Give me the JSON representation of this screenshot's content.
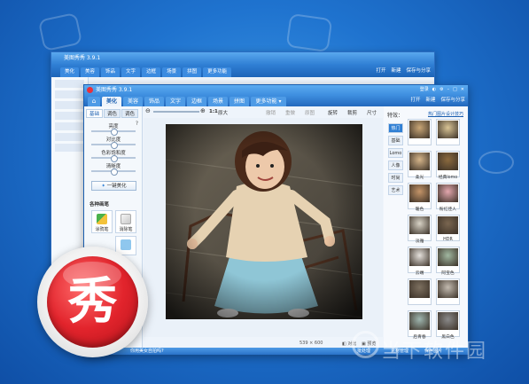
{
  "background_window": {
    "title": "美图秀秀 3.9.1",
    "tabs": [
      "美化",
      "美容",
      "饰品",
      "文字",
      "边框",
      "场景",
      "拼图",
      "更多功能"
    ],
    "actions": [
      "打开",
      "新建",
      "保存与分享"
    ]
  },
  "window": {
    "title": "美图秀秀 3.9.1",
    "title_right": [
      "登录",
      "皮肤",
      "设置",
      "最小化",
      "最大化",
      "关闭"
    ],
    "tabs": [
      {
        "label": "美化",
        "active": true
      },
      {
        "label": "美容"
      },
      {
        "label": "饰品"
      },
      {
        "label": "文字"
      },
      {
        "label": "边框"
      },
      {
        "label": "场景"
      },
      {
        "label": "拼图"
      },
      {
        "label": "更多功能 ▾"
      }
    ],
    "topright": {
      "open": "打开",
      "new": "新建",
      "save": "保存与分享"
    }
  },
  "left_panel": {
    "subtabs": [
      {
        "label": "基础",
        "active": true
      },
      {
        "label": "调色"
      },
      {
        "label": "调色"
      }
    ],
    "sliders": [
      "亮度",
      "对比度",
      "色彩饱和度",
      "清晰度"
    ],
    "onekey_label": "一键美化",
    "section_title": "各种画笔",
    "tools": [
      {
        "label": "涂鸦笔",
        "icon": "pen-icon"
      },
      {
        "label": "消除笔",
        "icon": "eraser-icon"
      }
    ]
  },
  "toolbar": {
    "ratio": "1:1",
    "fit": "原大",
    "actions": [
      "撤销",
      "重做",
      "原图",
      "旋转",
      "裁剪",
      "尺寸"
    ]
  },
  "status_bar": {
    "size": "539 × 600",
    "compare_label": "对比",
    "preview_label": "预览"
  },
  "effects_panel": {
    "title": "特效：",
    "link": "热门图片设计技巧",
    "categories": [
      {
        "label": "热门",
        "active": true
      },
      {
        "label": "基础"
      },
      {
        "label": "Lomo"
      },
      {
        "label": "人像"
      },
      {
        "label": "时尚"
      },
      {
        "label": "艺术"
      }
    ],
    "thumbs": [
      {
        "label": "",
        "tone": "#c9a676"
      },
      {
        "label": "",
        "tone": "#d9c495"
      },
      {
        "label": "柔光",
        "tone": "#d6b58a"
      },
      {
        "label": "经典lomo",
        "tone": "#8b6a3f"
      },
      {
        "label": "暖色",
        "tone": "#c49468"
      },
      {
        "label": "粉红佳人",
        "tone": "#e3a7ae"
      },
      {
        "label": "淡雅",
        "tone": "#d8d3c6"
      },
      {
        "label": "HDR",
        "tone": "#7a6650"
      },
      {
        "label": "云端",
        "tone": "#e5e1dc"
      },
      {
        "label": "阿宝色",
        "tone": "#a1b8a1"
      },
      {
        "label": "",
        "tone": "#7d7060"
      },
      {
        "label": "",
        "tone": "#c3bbb0"
      },
      {
        "label": "后青春",
        "tone": "#9fb7b0"
      },
      {
        "label": "黑白色",
        "tone": "#8a8a8a"
      }
    ]
  },
  "bottom_bar": {
    "left": "你用美女自拍吗?",
    "right": [
      "批处理",
      "素材管理",
      "保存图片"
    ]
  },
  "app_icon_char": "秀",
  "watermark": "当下软件园",
  "colors": {
    "accent": "#2f7fd4",
    "icon_red": "#e2242c"
  }
}
